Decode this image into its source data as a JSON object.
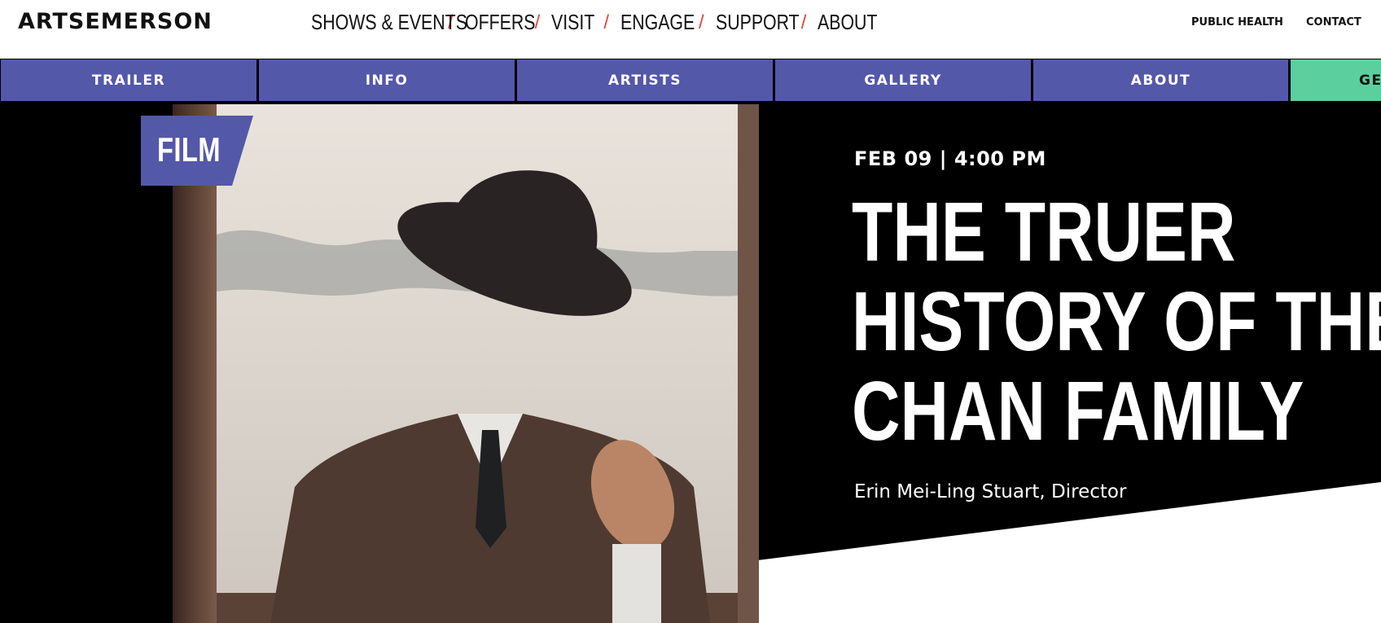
{
  "header": {
    "logo": "ARTSEMERSON",
    "nav": [
      {
        "label": "SHOWS & EVENTS",
        "sep": "/"
      },
      {
        "label": "OFFERS",
        "sep": "/"
      },
      {
        "label": "VISIT",
        "sep": "/"
      },
      {
        "label": "ENGAGE",
        "sep": "/"
      },
      {
        "label": "SUPPORT",
        "sep": "/"
      },
      {
        "label": "ABOUT",
        "sep": ""
      }
    ],
    "utility": {
      "public_health": "PUBLIC HEALTH",
      "contact": "CONTACT"
    }
  },
  "subnav": {
    "tabs": [
      "TRAILER",
      "INFO",
      "ARTISTS",
      "GALLERY",
      "ABOUT",
      "GE"
    ]
  },
  "event": {
    "category": "FILM",
    "date_time": "FEB 09 | 4:00 PM",
    "title_lines": [
      "THE TRUER",
      "HISTORY OF THE",
      "CHAN FAMILY"
    ],
    "credit": "Erin Mei-Ling Stuart, Director"
  },
  "colors": {
    "tab_purple": "#5458a8",
    "tab_green": "#5ccf9e",
    "separator_red": "#e0473d"
  }
}
